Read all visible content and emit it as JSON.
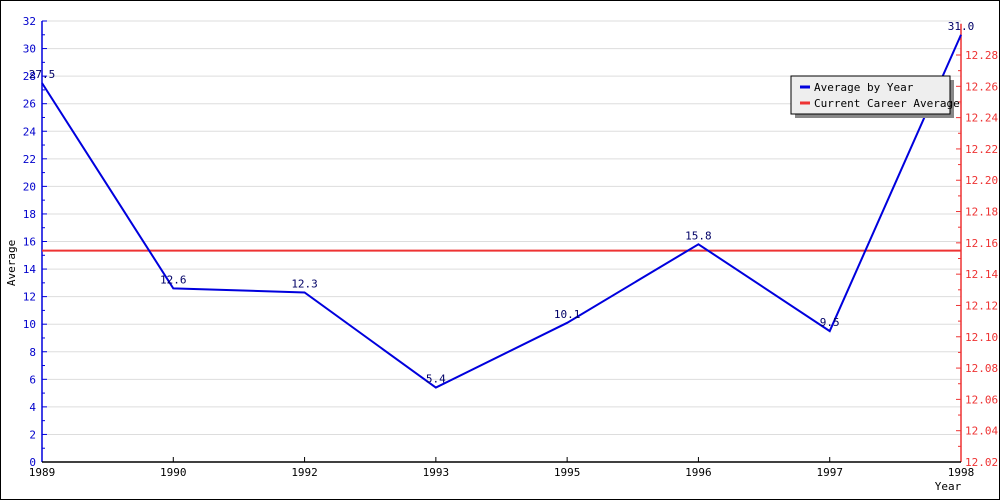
{
  "chart_data": {
    "type": "line",
    "title": "",
    "xlabel": "Year",
    "ylabel": "Average",
    "categories": [
      "1989",
      "1990",
      "1992",
      "1993",
      "1995",
      "1996",
      "1997",
      "1998"
    ],
    "series": [
      {
        "name": "Average by Year",
        "axis": "left",
        "color": "#0000dd",
        "values": [
          27.5,
          12.6,
          12.3,
          5.4,
          10.1,
          15.8,
          9.5,
          31.0
        ],
        "labels": [
          "27.5",
          "12.6",
          "12.3",
          "5.4",
          "10.1",
          "15.8",
          "9.5",
          "31.0"
        ]
      },
      {
        "name": "Current Career Average",
        "axis": "right",
        "color": "#ee3333",
        "constant": 12.155
      }
    ],
    "ylim": [
      0,
      32
    ],
    "yticks": [
      0,
      2,
      4,
      6,
      8,
      10,
      12,
      14,
      16,
      18,
      20,
      22,
      24,
      26,
      28,
      30,
      32
    ],
    "y2lim": [
      12.02,
      12.3
    ],
    "y2ticks": [
      "12.02",
      "12.04",
      "12.06",
      "12.08",
      "12.10",
      "12.12",
      "12.14",
      "12.16",
      "12.18",
      "12.20",
      "12.22",
      "12.24",
      "12.26",
      "12.28"
    ],
    "grid": true,
    "legend_position": "top-right"
  }
}
